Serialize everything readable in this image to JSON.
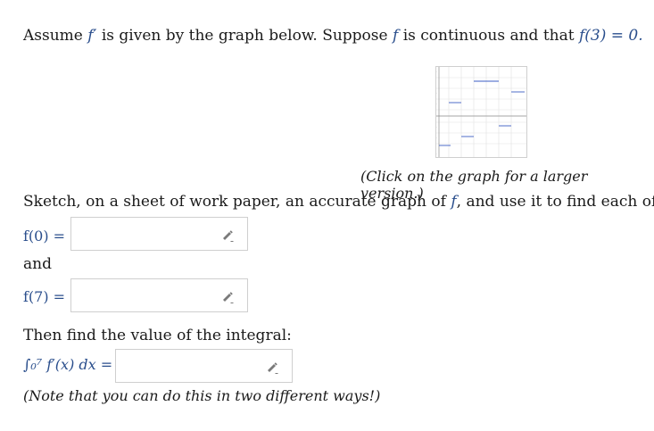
{
  "intro": {
    "assume": "Assume",
    "fprime": "f′",
    "given": "is given by the graph below. Suppose",
    "f": "f",
    "continuous": "is continuous and that",
    "condition": "f(3) = 0."
  },
  "graph": {
    "caption": "(Click on the graph for a larger version.)"
  },
  "sketch": {
    "text_before": "Sketch, on a sheet of work paper, an accurate graph of",
    "f": "f",
    "text_after": ", and use it to find each of"
  },
  "questions": [
    {
      "label": "f(0) =",
      "value": ""
    },
    {
      "label": "f(7) =",
      "value": ""
    }
  ],
  "and": "and",
  "integral": {
    "prompt": "Then find the value of the integral:",
    "label": "∫₀⁷ f′(x) dx =",
    "value": ""
  },
  "note": "(Note that you can do this in two different ways!)",
  "colors": {
    "accent": "#2a4e8c",
    "border": "#cfcfcf",
    "plot_lines": "#3b5cc4"
  }
}
